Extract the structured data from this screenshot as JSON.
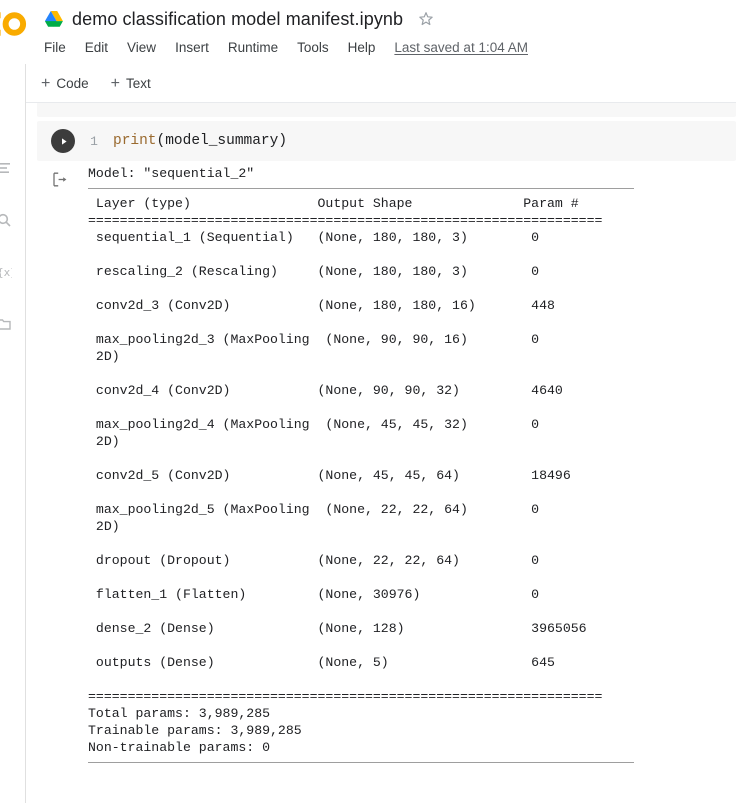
{
  "window": {
    "app_logo": "colab-logo",
    "drive_icon": "google-drive-icon",
    "star_icon": "star-outline-icon"
  },
  "header": {
    "doc_title": "demo classification model manifest.ipynb",
    "menu": [
      {
        "label": "File"
      },
      {
        "label": "Edit"
      },
      {
        "label": "View"
      },
      {
        "label": "Insert"
      },
      {
        "label": "Runtime"
      },
      {
        "label": "Tools"
      },
      {
        "label": "Help"
      }
    ],
    "saved_note": "Last saved at 1:04 AM"
  },
  "toolbar": {
    "add_code_label": "Code",
    "add_text_label": "Text",
    "plus_glyph": "+"
  },
  "rail": {
    "items": [
      {
        "name": "table-of-contents-icon"
      },
      {
        "name": "search-icon"
      },
      {
        "name": "variables-icon"
      },
      {
        "name": "files-icon"
      }
    ]
  },
  "cell": {
    "run_button_name": "run-cell-button",
    "line_number": "1",
    "code_prefix": "print",
    "code_suffix": "(model_summary)",
    "output_icon": "output-arrow-icon"
  },
  "output": {
    "model_line": "Model: \"sequential_2\"",
    "rule_top": "_________________________________________________________________",
    "columns_line": " Layer (type)                Output Shape              Param #   ",
    "eq_line": "=================================================================",
    "rows": [
      " sequential_1 (Sequential)   (None, 180, 180, 3)        0         ",
      "",
      " rescaling_2 (Rescaling)     (None, 180, 180, 3)        0         ",
      "",
      " conv2d_3 (Conv2D)           (None, 180, 180, 16)       448       ",
      "",
      " max_pooling2d_3 (MaxPooling  (None, 90, 90, 16)        0         ",
      " 2D)                                                              ",
      "",
      " conv2d_4 (Conv2D)           (None, 90, 90, 32)         4640      ",
      "",
      " max_pooling2d_4 (MaxPooling  (None, 45, 45, 32)        0         ",
      " 2D)                                                              ",
      "",
      " conv2d_5 (Conv2D)           (None, 45, 45, 64)         18496     ",
      "",
      " max_pooling2d_5 (MaxPooling  (None, 22, 22, 64)        0         ",
      " 2D)                                                              ",
      "",
      " dropout (Dropout)           (None, 22, 22, 64)         0         ",
      "",
      " flatten_1 (Flatten)         (None, 30976)              0         ",
      "",
      " dense_2 (Dense)             (None, 128)                3965056   ",
      "",
      " outputs (Dense)             (None, 5)                  645       ",
      ""
    ],
    "eq_line_bottom": "=================================================================",
    "totals": [
      "Total params: 3,989,285",
      "Trainable params: 3,989,285",
      "Non-trainable params: 0"
    ],
    "rule_bottom": "_________________________________________________________________"
  },
  "table_data": {
    "type": "table",
    "title": "Model: \"sequential_2\"",
    "columns": [
      "Layer (type)",
      "Output Shape",
      "Param #"
    ],
    "rows": [
      [
        "sequential_1 (Sequential)",
        "(None, 180, 180, 3)",
        "0"
      ],
      [
        "rescaling_2 (Rescaling)",
        "(None, 180, 180, 3)",
        "0"
      ],
      [
        "conv2d_3 (Conv2D)",
        "(None, 180, 180, 16)",
        "448"
      ],
      [
        "max_pooling2d_3 (MaxPooling2D)",
        "(None, 90, 90, 16)",
        "0"
      ],
      [
        "conv2d_4 (Conv2D)",
        "(None, 90, 90, 32)",
        "4640"
      ],
      [
        "max_pooling2d_4 (MaxPooling2D)",
        "(None, 45, 45, 32)",
        "0"
      ],
      [
        "conv2d_5 (Conv2D)",
        "(None, 45, 45, 64)",
        "18496"
      ],
      [
        "max_pooling2d_5 (MaxPooling2D)",
        "(None, 22, 22, 64)",
        "0"
      ],
      [
        "dropout (Dropout)",
        "(None, 22, 22, 64)",
        "0"
      ],
      [
        "flatten_1 (Flatten)",
        "(None, 30976)",
        "0"
      ],
      [
        "dense_2 (Dense)",
        "(None, 128)",
        "3965056"
      ],
      [
        "outputs (Dense)",
        "(None, 5)",
        "645"
      ]
    ],
    "total_params": "3,989,285",
    "trainable_params": "3,989,285",
    "non_trainable_params": "0"
  },
  "colors": {
    "cell_background": "#f7f7f7",
    "code_function": "#9a6a2f",
    "code_text": "#202124",
    "menu_text": "#3c4043",
    "muted_text": "#5f6368",
    "run_button": "#3c3c3c",
    "drive_blue": "#2684fc",
    "drive_green": "#00ac47",
    "drive_yellow": "#ffba00",
    "colab_orange": "#f9ab00"
  }
}
